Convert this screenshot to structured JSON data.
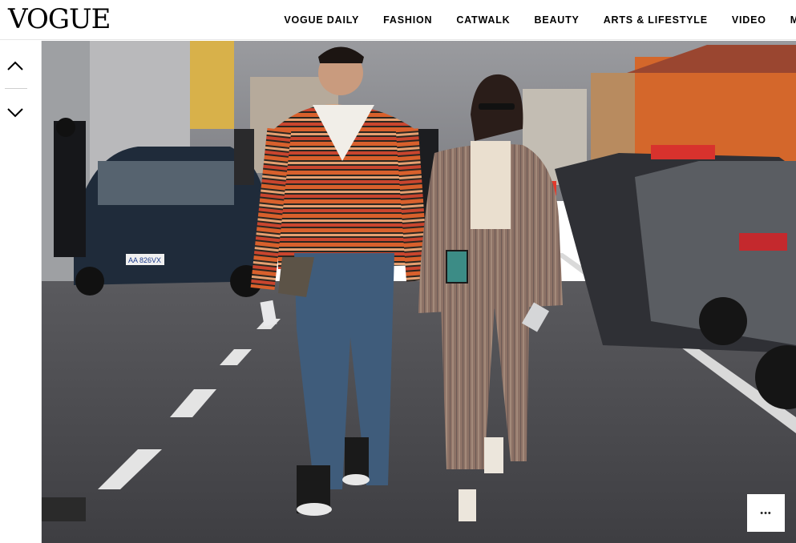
{
  "header": {
    "logo": "VOGUE",
    "nav": [
      "VOGUE DAILY",
      "FASHION",
      "CATWALK",
      "BEAUTY",
      "ARTS & LIFESTYLE",
      "VIDEO",
      "M"
    ]
  },
  "gallery": {
    "prev_icon": "chevron-up-icon",
    "next_icon": "chevron-down-icon",
    "more_icon": "ellipsis-icon",
    "more_label": "•••",
    "licence_plate": "AA 826VX"
  },
  "colors": {
    "text": "#000000",
    "divider": "#e6e6e6",
    "sweater_orange": "#d5602f",
    "road": "#4a4a4d",
    "sky": "#8d8f94"
  }
}
